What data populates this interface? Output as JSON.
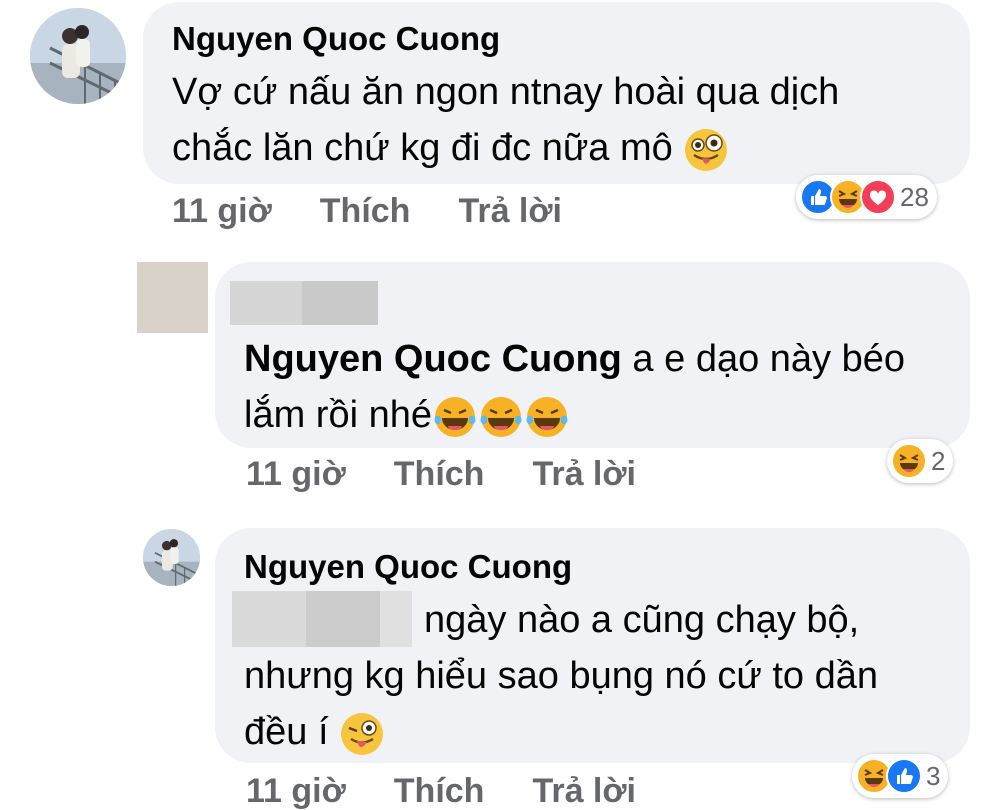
{
  "comments": [
    {
      "author": "Nguyen Quoc Cuong",
      "lines": [
        "Vợ cứ nấu ăn ngon ntnay hoài qua dịch",
        "chắc lăn chứ kg đi đc nữa mô"
      ],
      "time": "11 giờ",
      "like_label": "Thích",
      "reply_label": "Trả lời",
      "reaction_icons": [
        "like-icon",
        "haha-icon",
        "love-icon"
      ],
      "reaction_count": "28"
    },
    {
      "mention": "Nguyen Quoc Cuong",
      "lines": [
        " a e dạo này béo",
        "lắm rồi nhé"
      ],
      "time": "11 giờ",
      "like_label": "Thích",
      "reply_label": "Trả lời",
      "reaction_icons": [
        "haha-icon"
      ],
      "reaction_count": "2"
    },
    {
      "author": "Nguyen Quoc Cuong",
      "lines": [
        "ngày nào a cũng chạy bộ,",
        "nhưng kg hiểu sao bụng nó cứ to dần",
        "đều í"
      ],
      "time": "11 giờ",
      "like_label": "Thích",
      "reply_label": "Trả lời",
      "reaction_icons": [
        "haha-icon",
        "like-icon"
      ],
      "reaction_count": "3"
    }
  ],
  "colors": {
    "bubble": "#f0f2f5",
    "meta_text": "#65676b",
    "like_blue": "#1877f2",
    "love_red": "#f33e58",
    "haha_yellow": "#f7b125"
  }
}
